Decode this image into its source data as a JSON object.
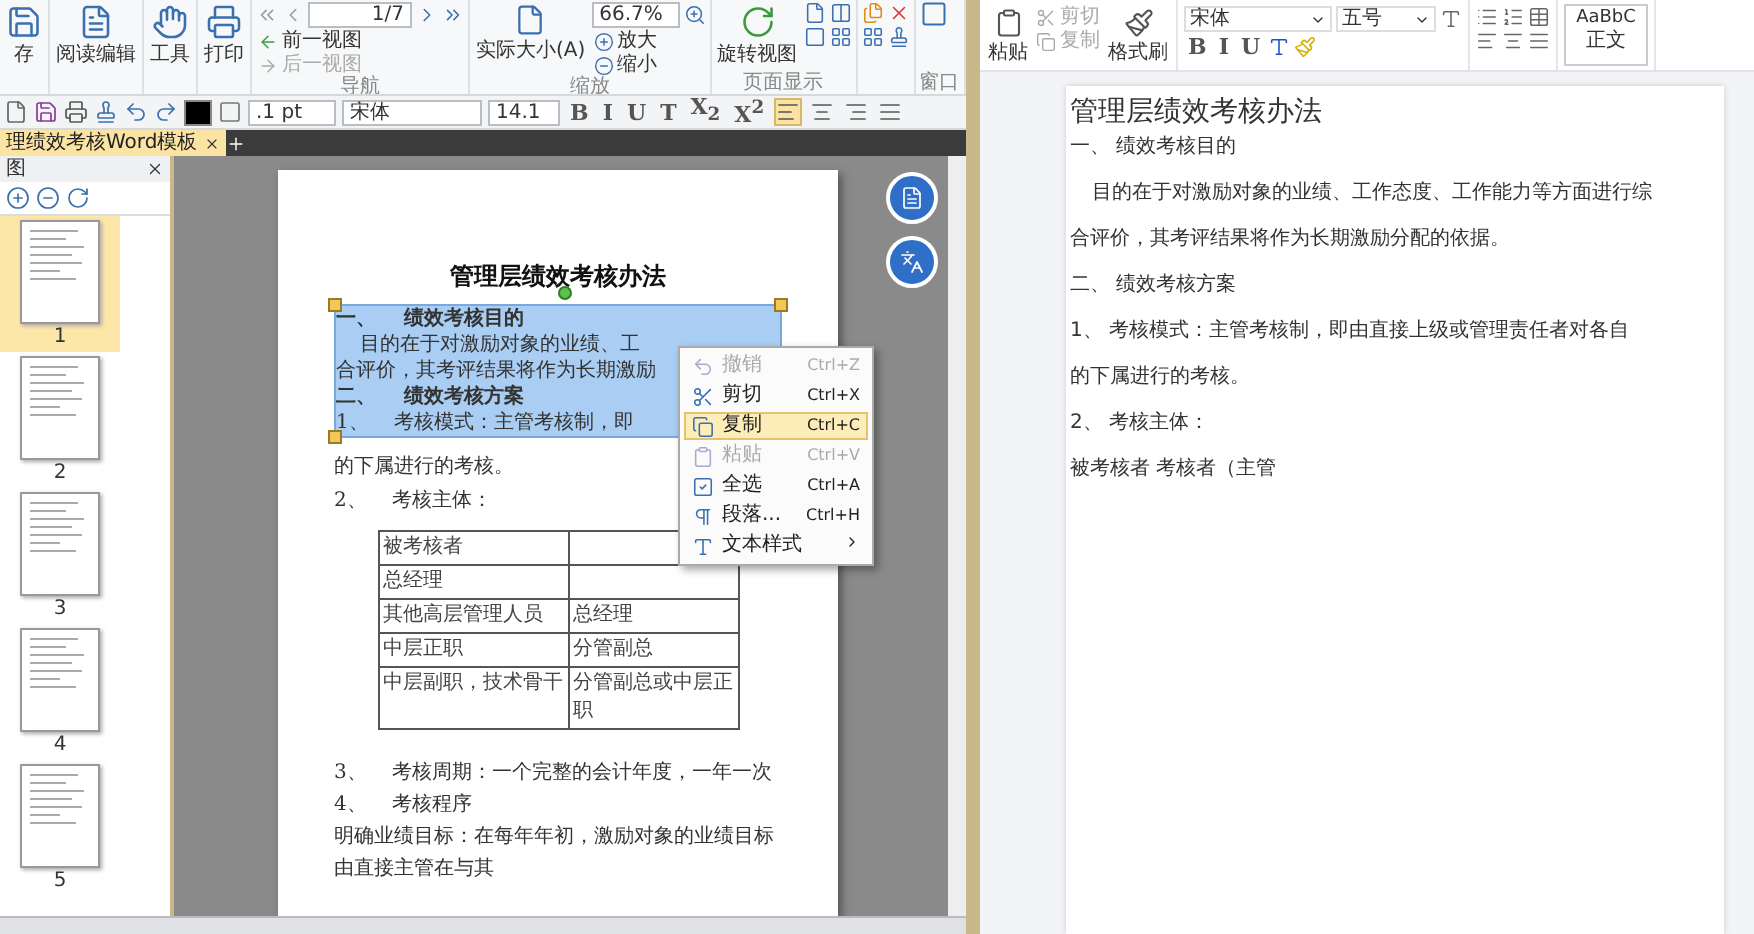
{
  "pdf_editor": {
    "ribbon": {
      "buttons": [
        {
          "kind": "save",
          "label": "存"
        },
        {
          "kind": "read_edit",
          "label": "阅读编辑"
        },
        {
          "kind": "tools",
          "label": "工具"
        },
        {
          "kind": "print",
          "label": "打印"
        }
      ],
      "navigation": {
        "page_field": "1/7",
        "previous_view": "前一视图",
        "next_view": "后一视图",
        "group_label": "导航"
      },
      "zoom": {
        "actual_size": "实际大小(A)",
        "zoom_field": "66.7%",
        "zoom_in": "放大",
        "zoom_out": "缩小",
        "group_label": "缩放"
      },
      "page_display": {
        "rotate_view": "旋转视图",
        "group_label": "页面显示"
      },
      "window": {
        "group_label": "窗口"
      }
    },
    "toolbar": {
      "line_width": ".1 pt",
      "font": "宋体",
      "font_size": "14.1",
      "text_styles": [
        "B",
        "I",
        "U",
        "T",
        "X$_{2}$",
        "X$^{2}$"
      ],
      "alignments": [
        {
          "kind": "left",
          "selected": true
        },
        {
          "kind": "center",
          "selected": false
        },
        {
          "kind": "right",
          "selected": false
        },
        {
          "kind": "justify",
          "selected": false
        }
      ]
    },
    "tabs": [
      {
        "label": "理绩效考核Word模板",
        "selected": true
      }
    ],
    "thumbnails": {
      "title": "图",
      "pages": [
        {
          "label": "1",
          "selected": true
        },
        {
          "label": "2",
          "selected": false
        },
        {
          "label": "3",
          "selected": false
        },
        {
          "label": "4",
          "selected": false
        },
        {
          "label": "5",
          "selected": false
        }
      ]
    },
    "document": {
      "title": "管理层绩效考核办法",
      "selected_lines": [
        {
          "kind": "heading",
          "text": "一、    绩效考核目的"
        },
        {
          "kind": "indented",
          "text": "目的在于对激励对象的业绩、工"
        },
        {
          "kind": "body",
          "text": "合评价，其考评结果将作为长期激励"
        },
        {
          "kind": "heading",
          "text": "二、    绩效考核方案"
        },
        {
          "kind": "body",
          "text": "1、    考核模式：主管考核制，即"
        }
      ],
      "lines_before_table": [
        "的下属进行的考核。",
        "2、    考核主体："
      ],
      "table": [
        {
          "assessee": "被考核者"
        },
        {
          "assessee": "总经理"
        },
        {
          "assessee": "其他高层管理人员",
          "assessor": "总经理"
        },
        {
          "assessee": "中层正职",
          "assessor": "分管副总"
        },
        {
          "assessee": "中层副职，技术骨干",
          "assessor": "分管副总或中层正职"
        }
      ],
      "lines_after_table": [
        "3、    考核周期：一个完整的会计年度，一年一次",
        "4、    考核程序",
        "明确业绩目标：在每年年初，激励对象的业绩目标由直接主管在与其"
      ]
    },
    "context_menu": [
      {
        "kind": "undo",
        "label": "撤销",
        "shortcut": "Ctrl+Z",
        "disabled": true,
        "selected": false,
        "submenu": false
      },
      {
        "kind": "cut",
        "label": "剪切",
        "shortcut": "Ctrl+X",
        "disabled": false,
        "selected": false,
        "submenu": false
      },
      {
        "kind": "copy",
        "label": "复制",
        "shortcut": "Ctrl+C",
        "disabled": false,
        "selected": true,
        "submenu": false
      },
      {
        "kind": "paste",
        "label": "粘贴",
        "shortcut": "Ctrl+V",
        "disabled": true,
        "selected": false,
        "submenu": false
      },
      {
        "kind": "select_all",
        "label": "全选",
        "shortcut": "Ctrl+A",
        "disabled": false,
        "selected": false,
        "submenu": false
      },
      {
        "kind": "paragraph",
        "label": "段落...",
        "shortcut": "Ctrl+H",
        "disabled": false,
        "selected": false,
        "submenu": false
      },
      {
        "kind": "text_style",
        "label": "文本样式",
        "disabled": false,
        "selected": false,
        "submenu": true
      }
    ]
  },
  "word_editor": {
    "ribbon": {
      "paste": "粘贴",
      "cut": {
        "label": "剪切",
        "disabled": true
      },
      "copy": {
        "label": "复制",
        "disabled": true
      },
      "format_painter": "格式刷",
      "font": "宋体",
      "font_size": "五号",
      "text_styles": [
        "B",
        "I",
        "U"
      ],
      "style_preview": "AaBbC",
      "style_name": "正文"
    },
    "document": {
      "title": "管理层绩效考核办法",
      "paragraphs": [
        {
          "kind": "plain",
          "text": "一、 绩效考核目的"
        },
        {
          "kind": "indented",
          "text": "目的在于对激励对象的业绩、工作态度、工作能力等方面进行综"
        },
        {
          "kind": "plain",
          "text": "合评价，其考评结果将作为长期激励分配的依据。"
        },
        {
          "kind": "plain",
          "text": "二、 绩效考核方案"
        },
        {
          "kind": "plain",
          "text": "1、 考核模式：主管考核制，即由直接上级或管理责任者对各自"
        },
        {
          "kind": "plain",
          "text": "的下属进行的考核。"
        },
        {
          "kind": "plain",
          "text": "2、 考核主体："
        },
        {
          "kind": "plain",
          "text": "被考核者 考核者（主管"
        }
      ]
    }
  }
}
